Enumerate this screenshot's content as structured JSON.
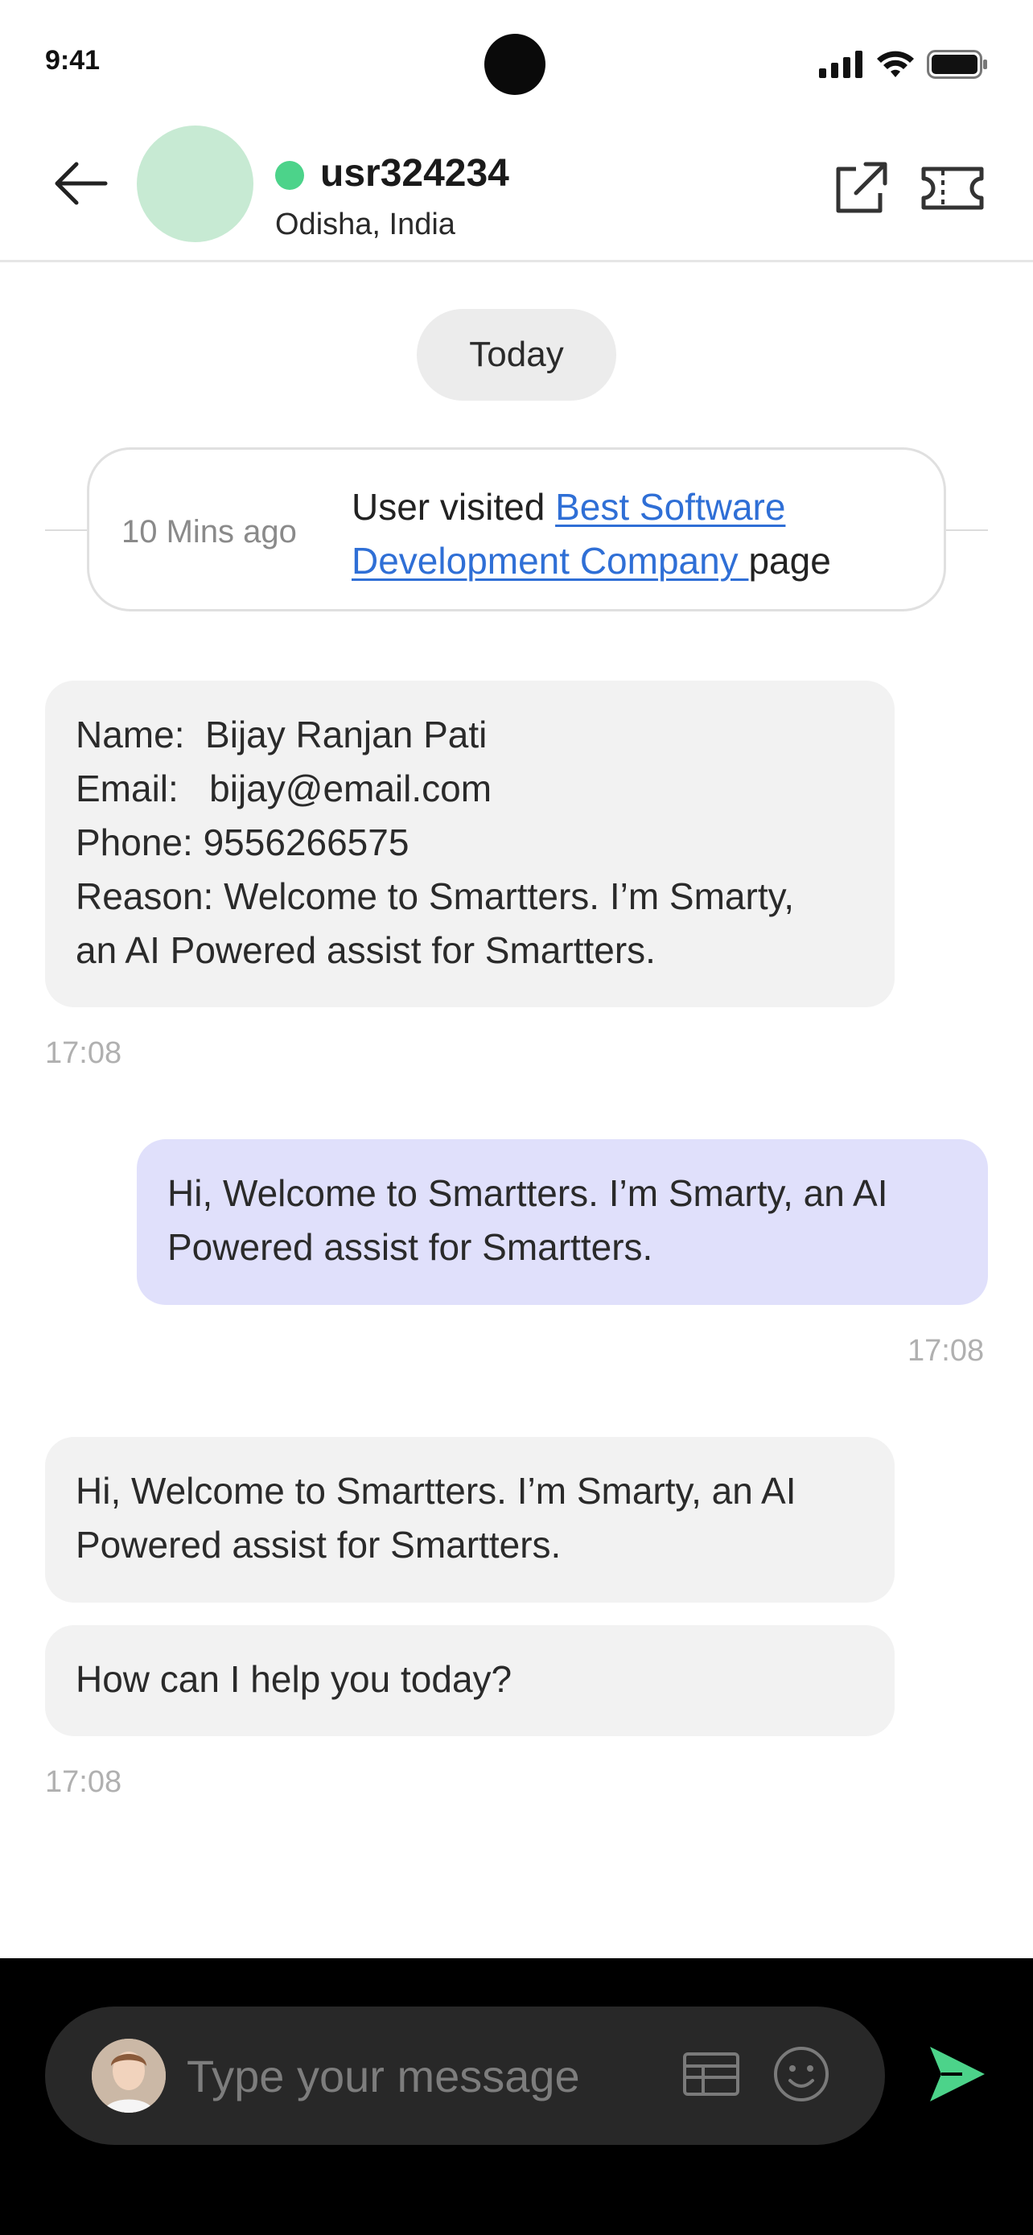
{
  "status_bar": {
    "time": "9:41",
    "icons": [
      "signal-icon",
      "wifi-icon",
      "battery-icon"
    ]
  },
  "header": {
    "username": "usr324234",
    "location": "Odisha, India",
    "online": true,
    "online_color": "#4cd38a",
    "avatar_color": "#c7ead3",
    "icons": [
      "back-arrow-icon",
      "external-link-icon",
      "ticket-icon"
    ]
  },
  "date_divider": "Today",
  "visit_event": {
    "time_ago": "10 Mins ago",
    "prefix": "User visited ",
    "link_text": "Best Software Development Company ",
    "suffix": "page",
    "link_color": "#2f6fd6"
  },
  "messages": [
    {
      "direction": "incoming",
      "lines": [
        "Name:  Bijay Ranjan Pati",
        "Email:   bijay@email.com",
        "Phone: 9556266575",
        "Reason: Welcome to Smartters. I’m Smarty,",
        "an AI Powered assist for Smartters."
      ],
      "time": "17:08"
    },
    {
      "direction": "outgoing",
      "lines": [
        "Hi, Welcome to Smartters. I’m Smarty, an AI",
        "Powered assist for Smartters."
      ],
      "time": "17:08"
    },
    {
      "direction": "incoming",
      "lines": [
        "Hi, Welcome to Smartters. I’m Smarty, an AI",
        "Powered assist for Smartters."
      ]
    },
    {
      "direction": "incoming",
      "lines": [
        "How can I help you today?"
      ],
      "time": "17:08"
    }
  ],
  "composer": {
    "placeholder": "Type your message",
    "icons": [
      "keyboard-icon",
      "emoji-icon",
      "send-icon"
    ],
    "send_color": "#4cd38a"
  }
}
